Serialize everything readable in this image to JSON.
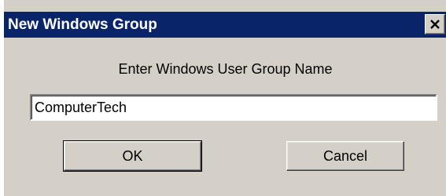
{
  "window": {
    "title": "New Windows Group",
    "close_icon": "close-icon"
  },
  "form": {
    "prompt": "Enter Windows User Group Name",
    "group_name_value": "ComputerTech"
  },
  "buttons": {
    "ok_label": "OK",
    "cancel_label": "Cancel"
  },
  "colors": {
    "titlebar": "#0a246a",
    "dialog_face": "#d4d0c8"
  }
}
